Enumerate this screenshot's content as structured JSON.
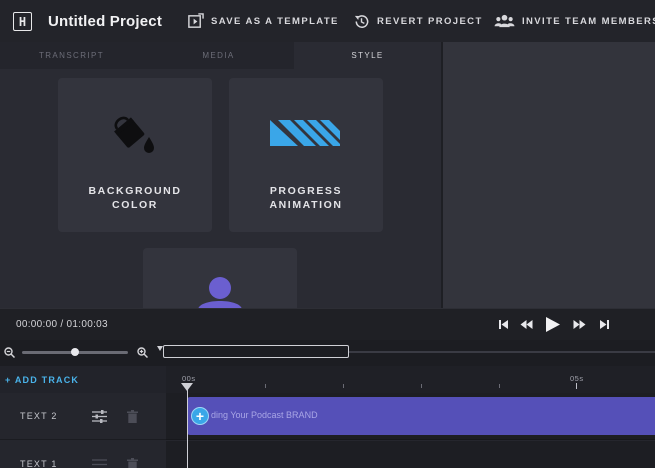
{
  "header": {
    "logo_letter": "H",
    "project_title": "Untitled Project",
    "save_template": "SAVE AS A TEMPLATE",
    "revert": "REVERT PROJECT",
    "invite": "INVITE TEAM MEMBERS"
  },
  "tabs": [
    {
      "label": "TRANSCRIPT"
    },
    {
      "label": "MEDIA"
    },
    {
      "label": "STYLE",
      "active": true
    }
  ],
  "style_cards": [
    {
      "line1": "BACKGROUND",
      "line2": "COLOR",
      "icon": "paint-bucket-icon"
    },
    {
      "line1": "PROGRESS",
      "line2": "ANIMATION",
      "icon": "progress-stripes-icon"
    },
    {
      "icon": "person-avatar-icon"
    }
  ],
  "transport": {
    "timecode": "00:00:00 / 01:00:03"
  },
  "timeline": {
    "add_track": "+ ADD TRACK",
    "ruler_labels": [
      "00s",
      "05s"
    ],
    "tracks": [
      {
        "name": "TEXT 2",
        "clip_text": "ding Your Podcast BRAND"
      },
      {
        "name": "TEXT 1"
      }
    ]
  },
  "colors": {
    "accent_blue": "#4ab3ea",
    "clip_purple": "#5550b8",
    "progress_icon": "#3aa6e8",
    "avatar_purple": "#6b5fd0"
  }
}
